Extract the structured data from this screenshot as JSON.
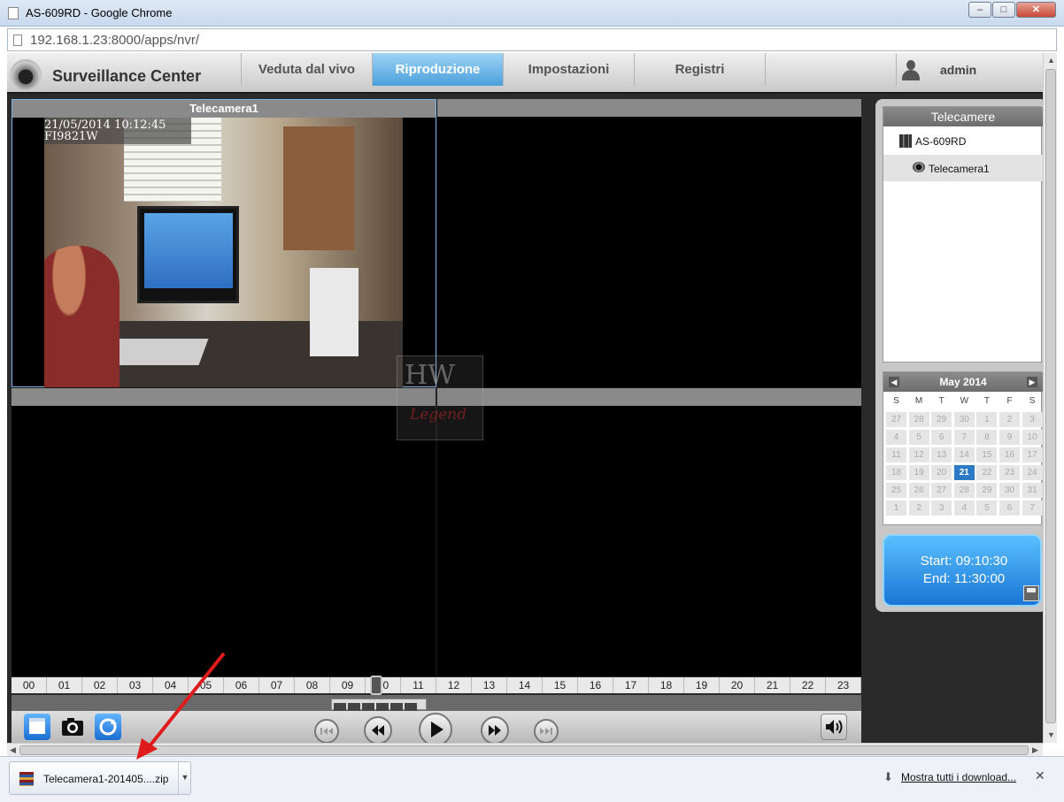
{
  "window": {
    "title": "AS-609RD - Google Chrome",
    "min": "–",
    "max": "□",
    "close": "✕"
  },
  "address": {
    "url": "192.168.1.23:8000/apps/nvr/"
  },
  "app": {
    "brand": "Surveillance Center",
    "tabs": [
      {
        "label": "Veduta dal vivo"
      },
      {
        "label": "Riproduzione",
        "active": true
      },
      {
        "label": "Impostazioni"
      },
      {
        "label": "Registri"
      }
    ],
    "user": "admin"
  },
  "video": {
    "pane1_title": "Telecamera1",
    "stamp_date": "21/05/2014 10:12:45",
    "stamp_id": "FI9821W",
    "watermark_top": "HW",
    "watermark_bottom": "Legend"
  },
  "timeline": {
    "hours": [
      "00",
      "01",
      "02",
      "03",
      "04",
      "05",
      "06",
      "07",
      "08",
      "09",
      "10",
      "11",
      "12",
      "13",
      "14",
      "15",
      "16",
      "17",
      "18",
      "19",
      "20",
      "21",
      "22",
      "23"
    ]
  },
  "cameras_panel": {
    "title": "Telecamere",
    "nvr": "AS-609RD",
    "camera": "Telecamera1"
  },
  "calendar": {
    "month": "May 2014",
    "dow": [
      "S",
      "M",
      "T",
      "W",
      "T",
      "F",
      "S"
    ],
    "days": [
      [
        "27",
        "28",
        "29",
        "30",
        "1",
        "2",
        "3"
      ],
      [
        "4",
        "5",
        "6",
        "7",
        "8",
        "9",
        "10"
      ],
      [
        "11",
        "12",
        "13",
        "14",
        "15",
        "16",
        "17"
      ],
      [
        "18",
        "19",
        "20",
        "21",
        "22",
        "23",
        "24"
      ],
      [
        "25",
        "26",
        "27",
        "28",
        "29",
        "30",
        "31"
      ],
      [
        "1",
        "2",
        "3",
        "4",
        "5",
        "6",
        "7"
      ]
    ],
    "selected": "21"
  },
  "time_range": {
    "start": "Start: 09:10:30",
    "end": "End: 11:30:00"
  },
  "download": {
    "filename": "Telecamera1-201405....zip",
    "show_all": "Mostra tutti i download..."
  },
  "icons": [
    "page-icon",
    "camera-logo-icon",
    "user-icon",
    "nvr-icon",
    "camera-icon",
    "save-icon",
    "playback-files-icon",
    "snapshot-icon",
    "refresh-icon",
    "skip-back-icon",
    "rewind-icon",
    "play-icon",
    "fast-forward-icon",
    "skip-forward-icon",
    "volume-icon",
    "zip-icon",
    "download-arrow-icon",
    "close-icon"
  ]
}
